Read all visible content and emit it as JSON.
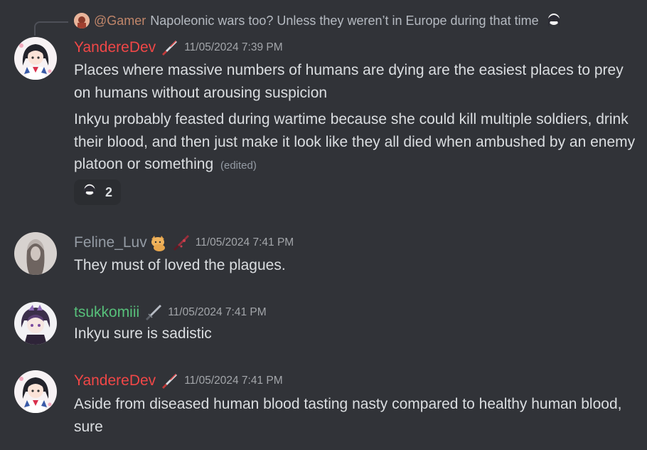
{
  "colors": {
    "background": "#313338",
    "username_yandere": "#f04747",
    "username_feline": "#949ba4",
    "username_tsukko": "#57c07a",
    "reply_username": "#c0866a",
    "timestamp": "#a3a6aa",
    "message_text": "#dbdee1"
  },
  "reply": {
    "username": "@Gamer",
    "text": "Napoleonic wars too? Unless they weren’t in Europe during that time",
    "emoji": "anime-girl-emoji"
  },
  "messages": [
    {
      "username": "YandereDev",
      "role_icon": "knife-icon",
      "timestamp": "11/05/2024 7:39 PM",
      "paragraphs": [
        "Places where massive numbers of humans are dying are the easiest places to prey on humans without arousing suspicion",
        "Inkyu probably feasted during wartime because she could kill multiple soldiers, drink their blood, and then just make it look like they all died when ambushed by an enemy platoon or something"
      ],
      "edited": "(edited)",
      "reaction": {
        "emoji": "anime-girl-emoji",
        "count": "2"
      }
    },
    {
      "username": "Feline_Luv",
      "username_emoji": "cat-emoji",
      "role_icon": "bloody-knife-icon",
      "timestamp": "11/05/2024 7:41 PM",
      "text": "They must of loved the plagues."
    },
    {
      "username": "tsukkomiii",
      "role_icon": "blade-icon",
      "timestamp": "11/05/2024 7:41 PM",
      "text": "Inkyu sure is sadistic"
    },
    {
      "username": "YandereDev",
      "role_icon": "knife-icon",
      "timestamp": "11/05/2024 7:41 PM",
      "text": "Aside from diseased human blood tasting nasty compared to healthy human blood, sure"
    }
  ]
}
